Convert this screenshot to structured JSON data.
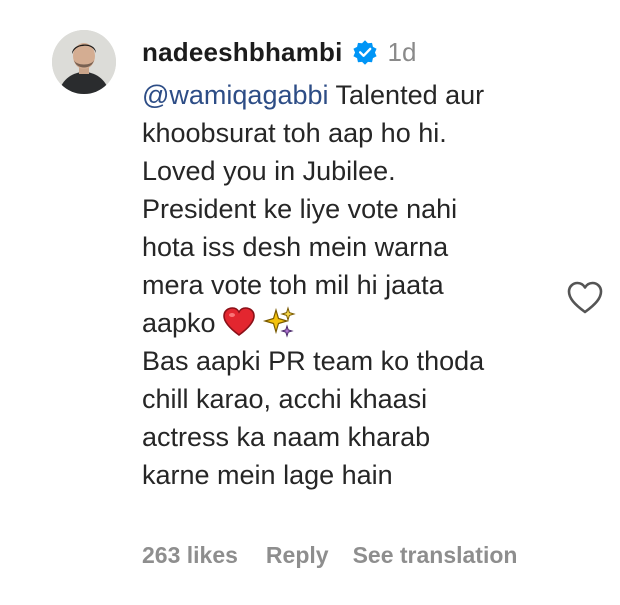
{
  "comment": {
    "author": {
      "username": "nadeeshbhambi",
      "avatar_icon": "profile-photo",
      "verified_icon": "verified-badge-icon",
      "verified_color": "#0095f6"
    },
    "timestamp": "1d",
    "lines": [
      {
        "mention": "@wamiqagabbi",
        "text": " Talented aur"
      },
      {
        "text": "khoobsurat toh aap ho hi."
      },
      {
        "text": "Loved you in Jubilee."
      },
      {
        "text": "President ke liye vote nahi"
      },
      {
        "text": "hota iss desh mein warna"
      },
      {
        "text": "mera vote toh mil hi jaata"
      },
      {
        "text": "aapko",
        "emojis": [
          "red-heart-emoji",
          "sparkles-emoji"
        ]
      },
      {
        "text": "Bas aapki PR team ko thoda"
      },
      {
        "text": "chill karao, acchi khaasi"
      },
      {
        "text": "actress ka naam kharab"
      },
      {
        "text": "karne mein lage hain"
      }
    ],
    "footer": {
      "likes": "263 likes",
      "reply_label": "Reply",
      "translate_label": "See translation"
    },
    "like_icon": "heart-outline-icon",
    "colors": {
      "mention": "#2d4d86",
      "muted": "#8e8e8e",
      "text": "#262626"
    }
  }
}
